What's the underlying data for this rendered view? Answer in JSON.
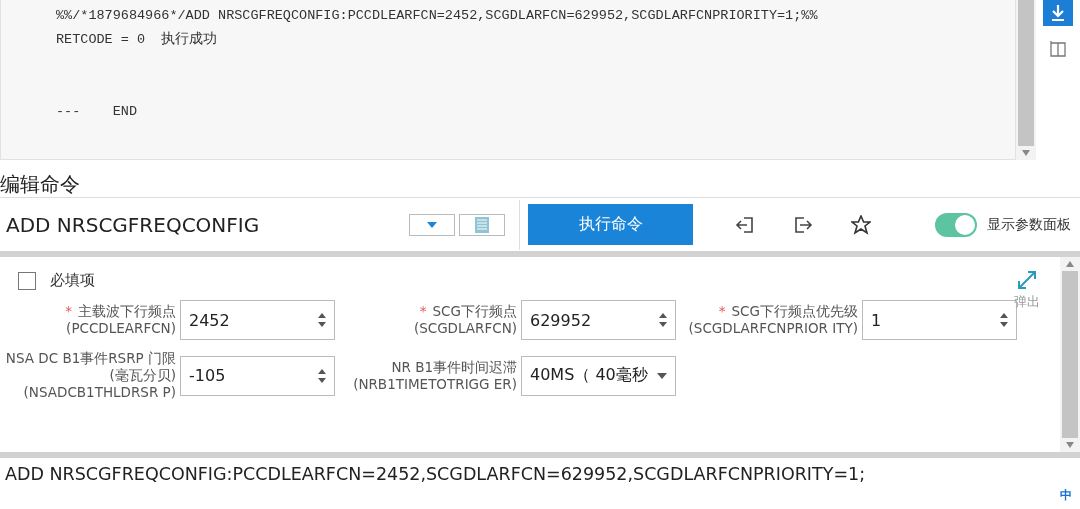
{
  "output": {
    "lines": [
      "%%/*1879684966*/ADD NRSCGFREQCONFIG:PCCDLEARFCN=2452,SCGDLARFCN=629952,SCGDLARFCNPRIORITY=1;%%",
      "RETCODE = 0  执行成功"
    ],
    "end_line": "---    END"
  },
  "edit_label": "编辑命令",
  "command": {
    "value": "ADD NRSCGFREQCONFIG",
    "run_button": "执行命令",
    "toggle": {
      "label": "显示参数面板",
      "on": true
    }
  },
  "params": {
    "required_only": {
      "label": "必填项",
      "checked": false
    },
    "popout": "弹出",
    "required_mark": "*",
    "fields": [
      {
        "kind": "spinner",
        "required": true,
        "label": "主载波下行频点",
        "code": "(PCCDLEARFCN)",
        "value": "2452"
      },
      {
        "kind": "spinner",
        "required": true,
        "label": "SCG下行频点",
        "code": "(SCGDLARFCN)",
        "value": "629952"
      },
      {
        "kind": "spinner",
        "required": true,
        "label": "SCG下行频点优先级",
        "code": "(SCGDLARFCNPRIOR ITY)",
        "value": "1"
      },
      {
        "kind": "spinner",
        "required": false,
        "label": "NSA DC B1事件RSRP 门限(毫瓦分贝)",
        "code": "(NSADCB1THLDRSR P)",
        "value": "-105"
      },
      {
        "kind": "select",
        "required": false,
        "label": "NR B1事件时间迟滞",
        "code": "(NRB1TIMETOTRIGG ER)",
        "value": "40MS（ 40毫秒"
      }
    ]
  },
  "preview": "ADD NRSCGFREQCONFIG:PCCDLEARFCN=2452,SCGDLARFCN=629952,SCGDLARFCNPRIORITY=1;",
  "ime": "中"
}
